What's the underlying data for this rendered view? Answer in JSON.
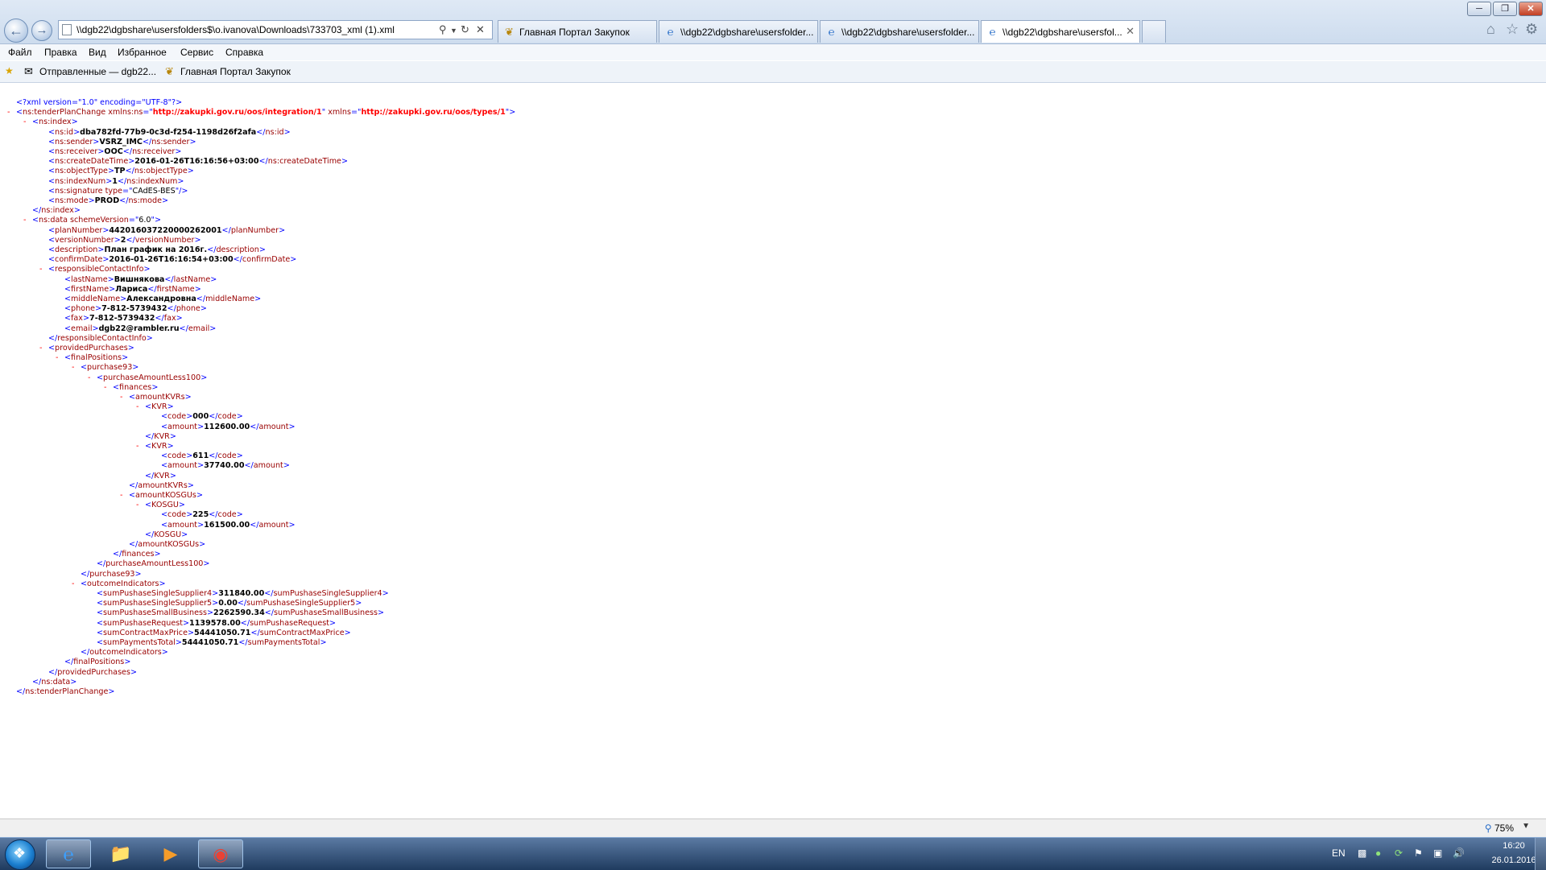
{
  "browser": {
    "address": "\\\\dgb22\\dgbshare\\usersfolders$\\o.ivanova\\Downloads\\733703_xml (1).xml",
    "tabs": [
      {
        "label": "Главная Портал Закупок",
        "icon": "emblem-icon"
      },
      {
        "label": "\\\\dgb22\\dgbshare\\usersfolder...",
        "icon": "ie-icon"
      },
      {
        "label": "\\\\dgb22\\dgbshare\\usersfolder...",
        "icon": "ie-icon"
      },
      {
        "label": "\\\\dgb22\\dgbshare\\usersfol...",
        "icon": "ie-icon",
        "active": true
      }
    ],
    "menu": [
      "Файл",
      "Правка",
      "Вид",
      "Избранное",
      "Сервис",
      "Справка"
    ],
    "favorites": [
      "Отправленные — dgb22...",
      "Главная Портал Закупок"
    ],
    "zoom": "75%"
  },
  "xml_lines": [
    {
      "i": 0,
      "pi": "<?xml version=\"1.0\" encoding=\"UTF-8\"?>"
    },
    {
      "i": 0,
      "dash": true,
      "open": "ns:tenderPlanChange",
      "attrs": [
        [
          "xmlns:ns",
          "http://zakupki.gov.ru/oos/integration/1"
        ],
        [
          "xmlns",
          "http://zakupki.gov.ru/oos/types/1"
        ]
      ],
      "red": true
    },
    {
      "i": 1,
      "dash": true,
      "open": "ns:index"
    },
    {
      "i": 2,
      "tag": "ns:id",
      "text": "dba782fd-77b9-0c3d-f254-1198d26f2afa"
    },
    {
      "i": 2,
      "tag": "ns:sender",
      "text": "VSRZ_IMC"
    },
    {
      "i": 2,
      "tag": "ns:receiver",
      "text": "OOC"
    },
    {
      "i": 2,
      "tag": "ns:createDateTime",
      "text": "2016-01-26T16:16:56+03:00"
    },
    {
      "i": 2,
      "tag": "ns:objectType",
      "text": "TP"
    },
    {
      "i": 2,
      "tag": "ns:indexNum",
      "text": "1"
    },
    {
      "i": 2,
      "empty": "ns:signature",
      "attrs": [
        [
          "type",
          "CAdES-BES"
        ]
      ]
    },
    {
      "i": 2,
      "tag": "ns:mode",
      "text": "PROD"
    },
    {
      "i": 1,
      "close": "ns:index"
    },
    {
      "i": 1,
      "dash": true,
      "open": "ns:data",
      "attrs": [
        [
          "schemeVersion",
          "6.0"
        ]
      ]
    },
    {
      "i": 2,
      "tag": "planNumber",
      "text": "442016037220000262001"
    },
    {
      "i": 2,
      "tag": "versionNumber",
      "text": "2"
    },
    {
      "i": 2,
      "tag": "description",
      "text": "План график на 2016г."
    },
    {
      "i": 2,
      "tag": "confirmDate",
      "text": "2016-01-26T16:16:54+03:00"
    },
    {
      "i": 2,
      "dash": true,
      "open": "responsibleContactInfo"
    },
    {
      "i": 3,
      "tag": "lastName",
      "text": "Вишнякова"
    },
    {
      "i": 3,
      "tag": "firstName",
      "text": "Лариса"
    },
    {
      "i": 3,
      "tag": "middleName",
      "text": "Александровна"
    },
    {
      "i": 3,
      "tag": "phone",
      "text": "7-812-5739432"
    },
    {
      "i": 3,
      "tag": "fax",
      "text": "7-812-5739432"
    },
    {
      "i": 3,
      "tag": "email",
      "text": "dgb22@rambler.ru"
    },
    {
      "i": 2,
      "close": "responsibleContactInfo"
    },
    {
      "i": 2,
      "dash": true,
      "open": "providedPurchases"
    },
    {
      "i": 3,
      "dash": true,
      "open": "finalPositions"
    },
    {
      "i": 4,
      "dash": true,
      "open": "purchase93"
    },
    {
      "i": 5,
      "dash": true,
      "open": "purchaseAmountLess100"
    },
    {
      "i": 6,
      "dash": true,
      "open": "finances"
    },
    {
      "i": 7,
      "dash": true,
      "open": "amountKVRs"
    },
    {
      "i": 8,
      "dash": true,
      "open": "KVR"
    },
    {
      "i": 9,
      "tag": "code",
      "text": "000"
    },
    {
      "i": 9,
      "tag": "amount",
      "text": "112600.00"
    },
    {
      "i": 8,
      "close": "KVR"
    },
    {
      "i": 8,
      "dash": true,
      "open": "KVR"
    },
    {
      "i": 9,
      "tag": "code",
      "text": "611"
    },
    {
      "i": 9,
      "tag": "amount",
      "text": "37740.00"
    },
    {
      "i": 8,
      "close": "KVR"
    },
    {
      "i": 7,
      "close": "amountKVRs"
    },
    {
      "i": 7,
      "dash": true,
      "open": "amountKOSGUs"
    },
    {
      "i": 8,
      "dash": true,
      "open": "KOSGU"
    },
    {
      "i": 9,
      "tag": "code",
      "text": "225"
    },
    {
      "i": 9,
      "tag": "amount",
      "text": "161500.00"
    },
    {
      "i": 8,
      "close": "KOSGU"
    },
    {
      "i": 7,
      "close": "amountKOSGUs"
    },
    {
      "i": 6,
      "close": "finances"
    },
    {
      "i": 5,
      "close": "purchaseAmountLess100"
    },
    {
      "i": 4,
      "close": "purchase93"
    },
    {
      "i": 4,
      "dash": true,
      "open": "outcomeIndicators"
    },
    {
      "i": 5,
      "tag": "sumPushaseSingleSupplier4",
      "text": "311840.00"
    },
    {
      "i": 5,
      "tag": "sumPushaseSingleSupplier5",
      "text": "0.00"
    },
    {
      "i": 5,
      "tag": "sumPushaseSmallBusiness",
      "text": "2262590.34"
    },
    {
      "i": 5,
      "tag": "sumPushaseRequest",
      "text": "1139578.00"
    },
    {
      "i": 5,
      "tag": "sumContractMaxPrice",
      "text": "54441050.71"
    },
    {
      "i": 5,
      "tag": "sumPaymentsTotal",
      "text": "54441050.71"
    },
    {
      "i": 4,
      "close": "outcomeIndicators"
    },
    {
      "i": 3,
      "close": "finalPositions"
    },
    {
      "i": 2,
      "close": "providedPurchases"
    },
    {
      "i": 1,
      "close": "ns:data"
    },
    {
      "i": 0,
      "close": "ns:tenderPlanChange"
    }
  ],
  "taskbar": {
    "lang": "EN",
    "time": "16:20",
    "date": "26.01.2016"
  },
  "colors": {
    "markup": "#0000ff",
    "tag": "#990000",
    "dash": "#ff0000",
    "url": "#ff0000"
  }
}
